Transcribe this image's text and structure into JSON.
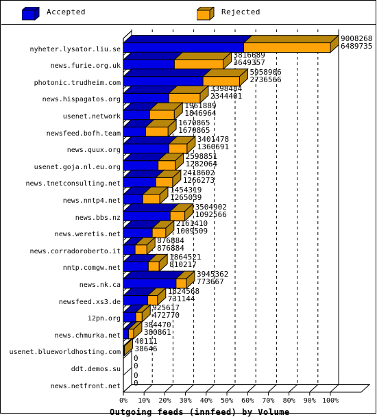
{
  "legend": {
    "items": [
      {
        "label": "Accepted",
        "color": "#0000e6",
        "icon": "cube-icon"
      },
      {
        "label": "Rejected",
        "color": "#ffa408",
        "icon": "cube-icon"
      }
    ]
  },
  "axis": {
    "x_title": "Outgoing feeds (innfeed) by Volume",
    "x_ticks": [
      "0%",
      "10%",
      "20%",
      "30%",
      "40%",
      "50%",
      "60%",
      "70%",
      "80%",
      "90%",
      "100%"
    ]
  },
  "chart_data": {
    "type": "bar",
    "title": "Outgoing feeds (innfeed) by Volume",
    "xlabel": "Outgoing feeds (innfeed) by Volume",
    "ylabel": "",
    "orientation": "horizontal",
    "stacked": true,
    "grid": true,
    "legend_position": "top",
    "xlim": [
      0,
      100
    ],
    "xticks": [
      0,
      10,
      20,
      30,
      40,
      50,
      60,
      70,
      80,
      90,
      100
    ],
    "xtick_labels": [
      "0%",
      "10%",
      "20%",
      "30%",
      "40%",
      "50%",
      "60%",
      "70%",
      "80%",
      "90%",
      "100%"
    ],
    "max_total": 15498003,
    "categories": [
      "nyheter.lysator.liu.se",
      "news.furie.org.uk",
      "photonic.trudheim.com",
      "news.hispagatos.org",
      "usenet.network",
      "newsfeed.bofh.team",
      "news.quux.org",
      "usenet.goja.nl.eu.org",
      "news.tnetconsulting.net",
      "news.nntp4.net",
      "news.bbs.nz",
      "news.weretis.net",
      "news.corradoroberto.it",
      "nntp.comgw.net",
      "news.nk.ca",
      "newsfeed.xs3.de",
      "i2pn.org",
      "news.chmurka.net",
      "usenet.blueworldhosting.com",
      "ddt.demos.su",
      "news.netfront.net"
    ],
    "series": [
      {
        "name": "Accepted",
        "color": "#0000e6",
        "values": [
          9008268,
          3816689,
          5958906,
          3398484,
          1961889,
          1670865,
          3401478,
          2598851,
          2418602,
          1454319,
          3504902,
          2161410,
          876884,
          1864521,
          3945362,
          1824568,
          925617,
          384470,
          40111,
          0,
          0
        ]
      },
      {
        "name": "Rejected",
        "color": "#ffa408",
        "values": [
          6489735,
          3649357,
          2736566,
          2344401,
          1846964,
          1670865,
          1360691,
          1282064,
          1266273,
          1265039,
          1092566,
          1009509,
          876884,
          810217,
          773667,
          731144,
          472770,
          380861,
          38646,
          0,
          0
        ]
      }
    ],
    "rows": [
      {
        "label": "nyheter.lysator.liu.se",
        "accepted": 9008268,
        "rejected": 6489735,
        "accepted_pct": 58.13,
        "rejected_pct": 41.87
      },
      {
        "label": "news.furie.org.uk",
        "accepted": 3816689,
        "rejected": 3649357,
        "accepted_pct": 24.63,
        "rejected_pct": 23.55
      },
      {
        "label": "photonic.trudheim.com",
        "accepted": 5958906,
        "rejected": 2736566,
        "accepted_pct": 38.45,
        "rejected_pct": 17.66
      },
      {
        "label": "news.hispagatos.org",
        "accepted": 3398484,
        "rejected": 2344401,
        "accepted_pct": 21.93,
        "rejected_pct": 15.13
      },
      {
        "label": "usenet.network",
        "accepted": 1961889,
        "rejected": 1846964,
        "accepted_pct": 12.66,
        "rejected_pct": 11.92
      },
      {
        "label": "newsfeed.bofh.team",
        "accepted": 1670865,
        "rejected": 1670865,
        "accepted_pct": 10.78,
        "rejected_pct": 10.78
      },
      {
        "label": "news.quux.org",
        "accepted": 3401478,
        "rejected": 1360691,
        "accepted_pct": 21.95,
        "rejected_pct": 8.78
      },
      {
        "label": "usenet.goja.nl.eu.org",
        "accepted": 2598851,
        "rejected": 1282064,
        "accepted_pct": 16.77,
        "rejected_pct": 8.27
      },
      {
        "label": "news.tnetconsulting.net",
        "accepted": 2418602,
        "rejected": 1266273,
        "accepted_pct": 15.61,
        "rejected_pct": 8.17
      },
      {
        "label": "news.nntp4.net",
        "accepted": 1454319,
        "rejected": 1265039,
        "accepted_pct": 9.38,
        "rejected_pct": 8.16
      },
      {
        "label": "news.bbs.nz",
        "accepted": 3504902,
        "rejected": 1092566,
        "accepted_pct": 22.61,
        "rejected_pct": 7.05
      },
      {
        "label": "news.weretis.net",
        "accepted": 2161410,
        "rejected": 1009509,
        "accepted_pct": 13.95,
        "rejected_pct": 6.51
      },
      {
        "label": "news.corradoroberto.it",
        "accepted": 876884,
        "rejected": 876884,
        "accepted_pct": 5.66,
        "rejected_pct": 5.66
      },
      {
        "label": "nntp.comgw.net",
        "accepted": 1864521,
        "rejected": 810217,
        "accepted_pct": 12.03,
        "rejected_pct": 5.23
      },
      {
        "label": "news.nk.ca",
        "accepted": 3945362,
        "rejected": 773667,
        "accepted_pct": 25.46,
        "rejected_pct": 4.99
      },
      {
        "label": "newsfeed.xs3.de",
        "accepted": 1824568,
        "rejected": 731144,
        "accepted_pct": 11.77,
        "rejected_pct": 4.72
      },
      {
        "label": "i2pn.org",
        "accepted": 925617,
        "rejected": 472770,
        "accepted_pct": 5.97,
        "rejected_pct": 3.05
      },
      {
        "label": "news.chmurka.net",
        "accepted": 384470,
        "rejected": 380861,
        "accepted_pct": 2.48,
        "rejected_pct": 2.46
      },
      {
        "label": "usenet.blueworldhosting.com",
        "accepted": 40111,
        "rejected": 38646,
        "accepted_pct": 0.26,
        "rejected_pct": 0.25
      },
      {
        "label": "ddt.demos.su",
        "accepted": 0,
        "rejected": 0,
        "accepted_pct": 0,
        "rejected_pct": 0
      },
      {
        "label": "news.netfront.net",
        "accepted": 0,
        "rejected": 0,
        "accepted_pct": 0,
        "rejected_pct": 0
      }
    ]
  }
}
